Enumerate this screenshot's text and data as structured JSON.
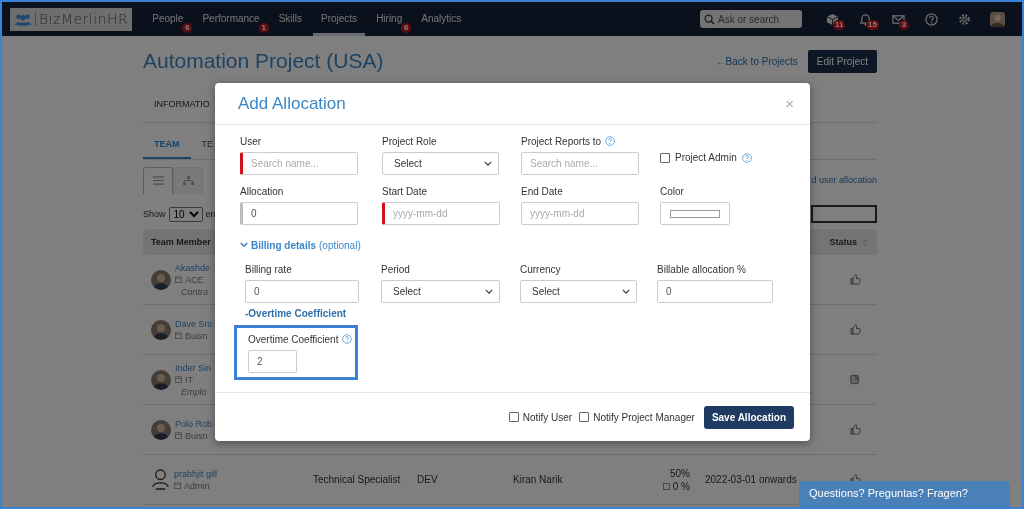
{
  "navbar": {
    "logo": "BizMerlinHR",
    "items": [
      {
        "label": "People",
        "badge": "6",
        "selected": false
      },
      {
        "label": "Performance",
        "badge": "1",
        "selected": false
      },
      {
        "label": "Skills",
        "selected": false
      },
      {
        "label": "Projects",
        "selected": true
      },
      {
        "label": "Hiring",
        "badge": "6",
        "selected": false
      },
      {
        "label": "Analytics",
        "selected": false
      }
    ],
    "search": {
      "placeholder": "Ask or search"
    },
    "icons": [
      {
        "kind": "box",
        "badge": "11"
      },
      {
        "kind": "bell",
        "badge": "15"
      },
      {
        "kind": "mail",
        "badge": "3"
      },
      {
        "kind": "help"
      },
      {
        "kind": "gear"
      },
      {
        "kind": "avatar"
      }
    ]
  },
  "page": {
    "title": "Automation Project (USA)",
    "back_link": "←Back to Projects",
    "edit_button": "Edit Project",
    "info_tab": "INFORMATIO",
    "team_tabs": [
      {
        "label": "TEAM",
        "selected": true
      },
      {
        "label": "TE",
        "selected": false
      }
    ],
    "views": [
      {
        "kind": "list",
        "selected": true
      },
      {
        "kind": "tree",
        "selected": false
      }
    ],
    "add_link": "d user allocation",
    "show_label": "Show",
    "show_value": "10",
    "show_suffix": "en",
    "columns": [
      "Team Member",
      "Status"
    ],
    "rows": [
      {
        "name": "Akashde",
        "dept": "ACE",
        "employment": "Contra",
        "avatar": {
          "kind": "photo"
        },
        "status": {
          "kind": "thumb"
        }
      },
      {
        "name": "Dave Sm",
        "dept": "Buisn",
        "avatar": {
          "kind": "photo"
        },
        "status": {
          "kind": "thumb"
        }
      },
      {
        "name": "Inder Sin",
        "dept": "IT",
        "employment": "Emplo",
        "avatar": {
          "kind": "photo"
        },
        "status": {
          "kind": "note"
        }
      },
      {
        "name": "Polo Rob",
        "dept": "Buisn",
        "avatar": {
          "kind": "photo"
        },
        "status": {
          "kind": "thumb"
        }
      },
      {
        "name": "prabhjit gill",
        "dept": "Admin",
        "avatar": {
          "kind": "outline"
        },
        "role": "Technical Specialist",
        "group": "DEV",
        "reports_to": "Kiran Narik",
        "allocation": "50%",
        "billable": "0 %",
        "dates": "2022-03-01 onwards",
        "status": {
          "kind": "thumb"
        }
      }
    ]
  },
  "modal": {
    "title": "Add Allocation",
    "close": "×",
    "rows": [
      [
        {
          "label": "User",
          "kind": "text",
          "placeholder": "Search name...",
          "required": true,
          "help": false
        },
        {
          "label": "Project Role",
          "kind": "select",
          "value": "Select",
          "help": false
        },
        {
          "label": "Project Reports to",
          "kind": "text",
          "placeholder": "Search name...",
          "help": true
        },
        {
          "label": "Project Admin",
          "kind": "checkbox",
          "checked": false,
          "help": true
        }
      ],
      [
        {
          "label": "Allocation",
          "kind": "text",
          "value": "0",
          "required": false,
          "help": false
        },
        {
          "label": "Start Date",
          "kind": "text",
          "placeholder": "yyyy-mm-dd",
          "required": true,
          "help": false
        },
        {
          "label": "End Date",
          "kind": "text",
          "placeholder": "yyyy-mm-dd",
          "help": false
        },
        {
          "label": "Color",
          "kind": "color",
          "color": "#ffffff",
          "help": false
        }
      ]
    ],
    "billing": {
      "toggle": "Billing details",
      "note": "(optional)",
      "expanded": true,
      "fields": [
        {
          "label": "Billing rate",
          "kind": "text",
          "value": "0"
        },
        {
          "label": "Period",
          "kind": "select",
          "value": "Select"
        },
        {
          "label": "Currency",
          "kind": "select",
          "value": "Select"
        },
        {
          "label": "Billable allocation %",
          "kind": "text",
          "value": "0"
        }
      ],
      "overtime_link": "-Overtime Coefficient",
      "overtime": {
        "label": "Overtime Coefficient",
        "value": "2",
        "highlighted": true
      }
    },
    "notify": [
      {
        "label": "Notify User",
        "checked": false
      },
      {
        "label": "Notify Project Manager",
        "checked": false
      }
    ],
    "save_button": "Save Allocation"
  },
  "chat": "Questions? Preguntas? Fragen?"
}
